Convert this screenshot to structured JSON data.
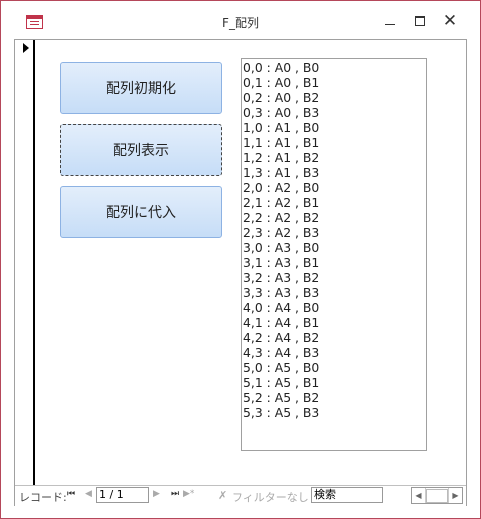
{
  "window": {
    "title": "F_配列",
    "min_label": "—",
    "max_label": "□",
    "close_label": "✕"
  },
  "buttons": {
    "init_label": "配列初期化",
    "show_label": "配列表示",
    "assign_label": "配列に代入"
  },
  "list": {
    "items": [
      "0,0 : A0 , B0",
      "0,1 : A0 , B1",
      "0,2 : A0 , B2",
      "0,3 : A0 , B3",
      "1,0 : A1 , B0",
      "1,1 : A1 , B1",
      "1,2 : A1 , B2",
      "1,3 : A1 , B3",
      "2,0 : A2 , B0",
      "2,1 : A2 , B1",
      "2,2 : A2 , B2",
      "2,3 : A2 , B3",
      "3,0 : A3 , B0",
      "3,1 : A3 , B1",
      "3,2 : A3 , B2",
      "3,3 : A3 , B3",
      "4,0 : A4 , B0",
      "4,1 : A4 , B1",
      "4,2 : A4 , B2",
      "4,3 : A4 , B3",
      "5,0 : A5 , B0",
      "5,1 : A5 , B1",
      "5,2 : A5 , B2",
      "5,3 : A5 , B3"
    ]
  },
  "navigation": {
    "record_label": "レコード:",
    "first_glyph": "⏮",
    "prev_glyph": "◀",
    "current": "1 / 1",
    "next_glyph": "▶",
    "last_glyph": "⏭",
    "new_glyph": "▶*",
    "filter_icon": "✗",
    "filter_label": "フィルターなし",
    "search_value": "検索",
    "scroll_left": "◀",
    "scroll_right": "▶"
  },
  "colors": {
    "window_border": "#b5475a",
    "button_top": "#e3eefb",
    "button_bottom": "#c6ddf7",
    "button_border": "#8db2e3"
  }
}
